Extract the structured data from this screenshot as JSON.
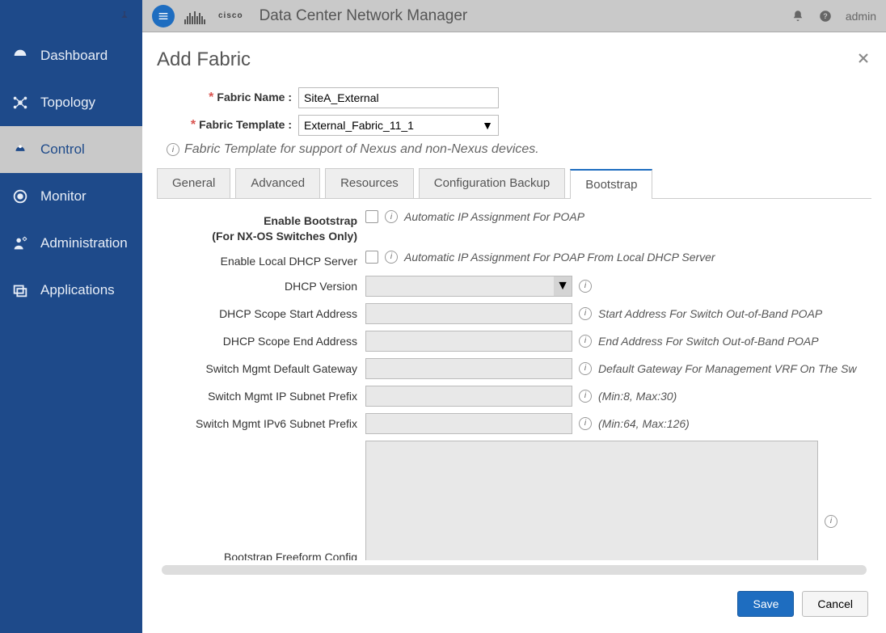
{
  "topbar": {
    "app_title": "Data Center Network Manager",
    "vendor": "cisco",
    "user": "admin"
  },
  "sidebar": {
    "items": [
      {
        "label": "Dashboard",
        "icon": "dashboard"
      },
      {
        "label": "Topology",
        "icon": "topology"
      },
      {
        "label": "Control",
        "icon": "control",
        "active": true
      },
      {
        "label": "Monitor",
        "icon": "monitor"
      },
      {
        "label": "Administration",
        "icon": "admin"
      },
      {
        "label": "Applications",
        "icon": "apps"
      }
    ]
  },
  "modal": {
    "title": "Add Fabric",
    "fabric_name_label": "Fabric Name :",
    "fabric_name_value": "SiteA_External",
    "fabric_template_label": "Fabric Template :",
    "fabric_template_value": "External_Fabric_11_1",
    "template_hint": "Fabric Template for support of Nexus and non-Nexus devices.",
    "tabs": [
      "General",
      "Advanced",
      "Resources",
      "Configuration Backup",
      "Bootstrap"
    ],
    "active_tab": "Bootstrap",
    "bootstrap": {
      "enable_bootstrap_label_l1": "Enable Bootstrap",
      "enable_bootstrap_label_l2": "(For NX-OS Switches Only)",
      "enable_bootstrap_hint": "Automatic IP Assignment For POAP",
      "enable_local_dhcp_label": "Enable Local DHCP Server",
      "enable_local_dhcp_hint": "Automatic IP Assignment For POAP From Local DHCP Server",
      "dhcp_version_label": "DHCP Version",
      "dhcp_start_label": "DHCP Scope Start Address",
      "dhcp_start_hint": "Start Address For Switch Out-of-Band POAP",
      "dhcp_end_label": "DHCP Scope End Address",
      "dhcp_end_hint": "End Address For Switch Out-of-Band POAP",
      "gateway_label": "Switch Mgmt Default Gateway",
      "gateway_hint": "Default Gateway For Management VRF On The Sw",
      "ip_prefix_label": "Switch Mgmt IP Subnet Prefix",
      "ip_prefix_hint": "(Min:8, Max:30)",
      "ipv6_prefix_label": "Switch Mgmt IPv6 Subnet Prefix",
      "ipv6_prefix_hint": "(Min:64, Max:126)",
      "freeform_label": "Bootstrap Freeform Config"
    },
    "buttons": {
      "save": "Save",
      "cancel": "Cancel"
    }
  }
}
